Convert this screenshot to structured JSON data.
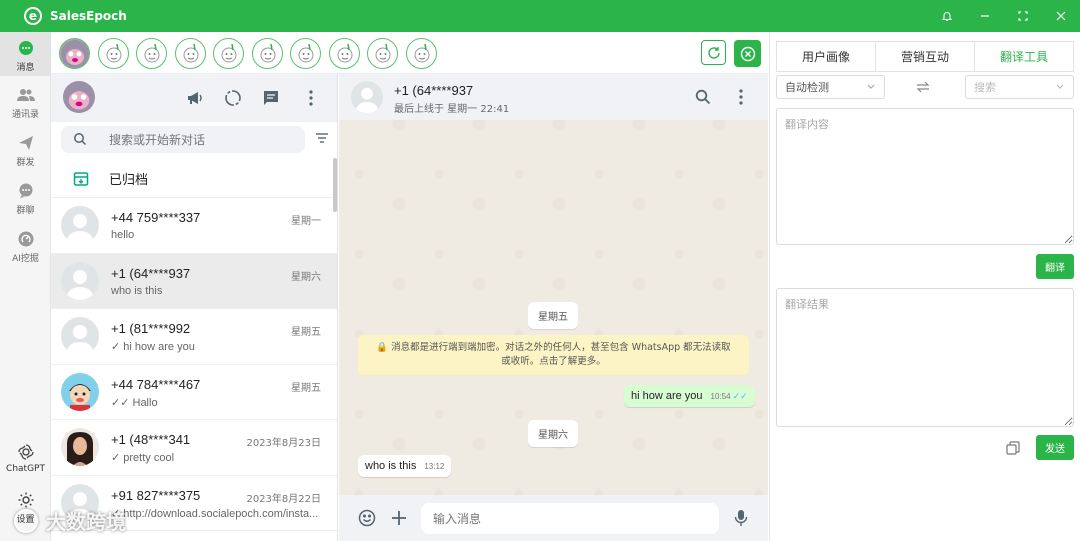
{
  "app": {
    "title": "SalesEpoch",
    "window_controls": [
      "bell-icon",
      "minimize-icon",
      "maximize-icon",
      "close-icon"
    ],
    "accent": "#2bb44a"
  },
  "rail": {
    "items": [
      {
        "label": "消息",
        "icon": "chat-bubble-icon",
        "active": true
      },
      {
        "label": "通讯录",
        "icon": "contacts-icon"
      },
      {
        "label": "群发",
        "icon": "send-icon"
      },
      {
        "label": "群聊",
        "icon": "group-chat-icon"
      },
      {
        "label": "AI挖掘",
        "icon": "ai-mining-icon"
      },
      {
        "label": "ChatGPT",
        "icon": "chatgpt-icon"
      },
      {
        "label": "设置",
        "icon": "settings-icon"
      }
    ]
  },
  "accounts": {
    "count": 10
  },
  "chat_list": {
    "search_placeholder": "搜索或开始新对话",
    "archived_label": "已归档",
    "chats": [
      {
        "name": "+44 759****337",
        "message": "hello",
        "time": "星期一",
        "tick": ""
      },
      {
        "name": "+1 (64****937",
        "message": "who is this",
        "time": "星期六",
        "tick": ""
      },
      {
        "name": "+1 (81****992",
        "message": "hi how are you",
        "time": "星期五",
        "tick": "✓ "
      },
      {
        "name": "+44 784****467",
        "message": "Hallo",
        "time": "星期五",
        "tick": "✓✓ "
      },
      {
        "name": "+1 (48****341",
        "message": "pretty cool",
        "time": "2023年8月23日",
        "tick": "✓ "
      },
      {
        "name": "+91 827****375",
        "message": "http://download.socialepoch.com/insta...",
        "time": "2023年8月22日",
        "tick": "✓ "
      }
    ]
  },
  "conversation": {
    "name": "+1 (64****937",
    "last_seen": "最后上线于 星期一 22:41",
    "date_1": "星期五",
    "encryption_note": "消息都是进行端到端加密。对话之外的任何人，甚至包含 WhatsApp 都无法读取或收听。点击了解更多。",
    "msg_out": {
      "text": "hi how are you",
      "time": "10:54"
    },
    "date_2": "星期六",
    "msg_in": {
      "text": "who is this",
      "time": "13:12"
    },
    "composer_placeholder": "输入消息"
  },
  "translate": {
    "tabs": [
      "用户画像",
      "营销互动",
      "翻译工具"
    ],
    "active_tab": 2,
    "source_lang": "自动检测",
    "target_lang_placeholder": "搜索",
    "input_placeholder": "翻译内容",
    "translate_btn": "翻译",
    "result_placeholder": "翻译结果",
    "send_btn": "发送"
  },
  "watermark": "大数跨境"
}
